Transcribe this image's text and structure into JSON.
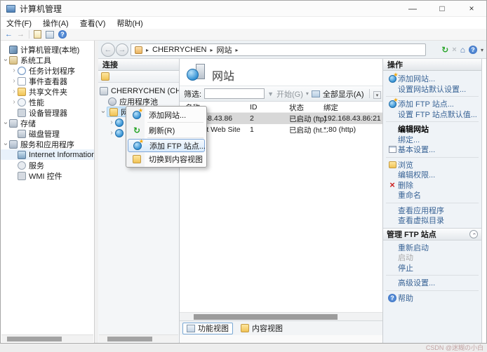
{
  "window": {
    "title": "计算机管理",
    "controls": {
      "minimize": "—",
      "maximize": "□",
      "close": "×"
    }
  },
  "menubar": {
    "items": [
      "文件(F)",
      "操作(A)",
      "查看(V)",
      "帮助(H)"
    ]
  },
  "address_bar": {
    "crumbs": [
      "CHERRYCHEN",
      "网站"
    ],
    "separator": "▸"
  },
  "left_tree": {
    "items": [
      {
        "label": "计算机管理(本地)"
      },
      {
        "label": "系统工具"
      },
      {
        "label": "任务计划程序"
      },
      {
        "label": "事件查看器"
      },
      {
        "label": "共享文件夹"
      },
      {
        "label": "性能"
      },
      {
        "label": "设备管理器"
      },
      {
        "label": "存储"
      },
      {
        "label": "磁盘管理"
      },
      {
        "label": "服务和应用程序"
      },
      {
        "label": "Internet Information Se"
      },
      {
        "label": "服务"
      },
      {
        "label": "WMI 控件"
      }
    ]
  },
  "connections": {
    "header": "连接",
    "server_label": "CHERRYCHEN (CHERRYC",
    "app_pools_label": "应用程序池",
    "sites_label": "网站"
  },
  "context_menu": {
    "items": [
      {
        "label": "添加网站..."
      },
      {
        "label": "刷新(R)"
      },
      {
        "label": "添加 FTP 站点..."
      },
      {
        "label": "切换到内容视图"
      }
    ]
  },
  "main": {
    "title": "网站",
    "filter": {
      "label": "筛选:",
      "go": "开始(G)",
      "show_all": "全部显示(A)"
    },
    "table": {
      "columns": [
        "名称",
        "ID",
        "状态",
        "绑定"
      ],
      "rows": [
        {
          "name": "192.168.43.86",
          "id": "2",
          "status": "已启动 (ftp)",
          "binding": "192.168.43.86:21"
        },
        {
          "name": "Default Web Site",
          "id": "1",
          "status": "已启动 (ht...",
          "binding": "*:80 (http)"
        }
      ]
    },
    "tabs": [
      {
        "label": "功能视图"
      },
      {
        "label": "内容视图"
      }
    ]
  },
  "actions": {
    "header": "操作",
    "items": [
      {
        "label": "添加网站..."
      },
      {
        "label": "设置网站默认设置..."
      },
      {
        "label": "添加 FTP 站点..."
      },
      {
        "label": "设置 FTP 站点默认值..."
      },
      {
        "label": "编辑网站"
      },
      {
        "label": "绑定..."
      },
      {
        "label": "基本设置..."
      },
      {
        "label": "浏览"
      },
      {
        "label": "编辑权限..."
      },
      {
        "label": "删除"
      },
      {
        "label": "重命名"
      },
      {
        "label": "查看应用程序"
      },
      {
        "label": "查看虚拟目录"
      },
      {
        "label": "管理 FTP 站点"
      },
      {
        "label": "重新启动"
      },
      {
        "label": "启动"
      },
      {
        "label": "停止"
      },
      {
        "label": "高级设置..."
      },
      {
        "label": "帮助"
      }
    ]
  },
  "colors": {
    "action_link": "#3a6496",
    "selected_row": "#d8d8d8",
    "menu_highlight_border": "#7da6d9"
  },
  "watermark": "CSDN @迷糊の小白"
}
